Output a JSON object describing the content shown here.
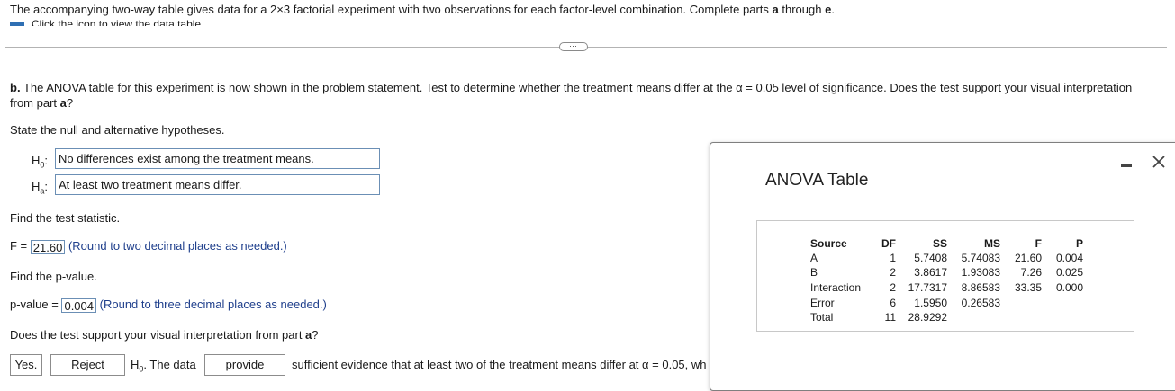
{
  "intro": {
    "text_before": "The accompanying two-way table gives data for a 2×3 factorial experiment with two observations for each factor-level combination. Complete parts ",
    "part_a": "a",
    "text_mid": " through ",
    "part_e": "e",
    "text_end": "."
  },
  "data_link": "Click the icon to view the data table.",
  "partb": {
    "label": "b.",
    "text": " The ANOVA table for this experiment is now shown in the problem statement. Test to determine whether the treatment means differ at the α = 0.05 level of significance. Does the test support your visual interpretation from part ",
    "ref": "a",
    "end": "?"
  },
  "hypotheses": {
    "prompt": "State the null and alternative hypotheses.",
    "h0_label": "H",
    "h0_sub": "0",
    "h0_value": "No differences exist among the treatment means.",
    "ha_label": "H",
    "ha_sub": "a",
    "ha_value": "At least two treatment means differ."
  },
  "statistic": {
    "prompt": "Find the test statistic.",
    "label": "F =",
    "value": "21.60",
    "hint": "(Round to two decimal places as needed.)"
  },
  "pvalue": {
    "prompt": "Find the p-value.",
    "label": "p-value =",
    "value": "0.004",
    "hint": "(Round to three decimal places as needed.)"
  },
  "support": {
    "prompt": "Does the test support your visual interpretation from part ",
    "ref": "a",
    "end": "?",
    "answer": "Yes.",
    "decision": "Reject",
    "h0_text": "H",
    "h0_sub": "0",
    "data_text": ". The data",
    "provide": "provide",
    "rest": "sufficient evidence that at least two of the treatment means differ at α = 0.05, wh"
  },
  "anova": {
    "title": "ANOVA Table",
    "headers": [
      "Source",
      "DF",
      "SS",
      "MS",
      "F",
      "P"
    ],
    "rows": [
      [
        "A",
        "1",
        "5.7408",
        "5.74083",
        "21.60",
        "0.004"
      ],
      [
        "B",
        "2",
        "3.8617",
        "1.93083",
        "7.26",
        "0.025"
      ],
      [
        "Interaction",
        "2",
        "17.7317",
        "8.86583",
        "33.35",
        "0.000"
      ],
      [
        "Error",
        "6",
        "1.5950",
        "0.26583",
        "",
        ""
      ],
      [
        "Total",
        "11",
        "28.9292",
        "",
        "",
        ""
      ]
    ]
  }
}
